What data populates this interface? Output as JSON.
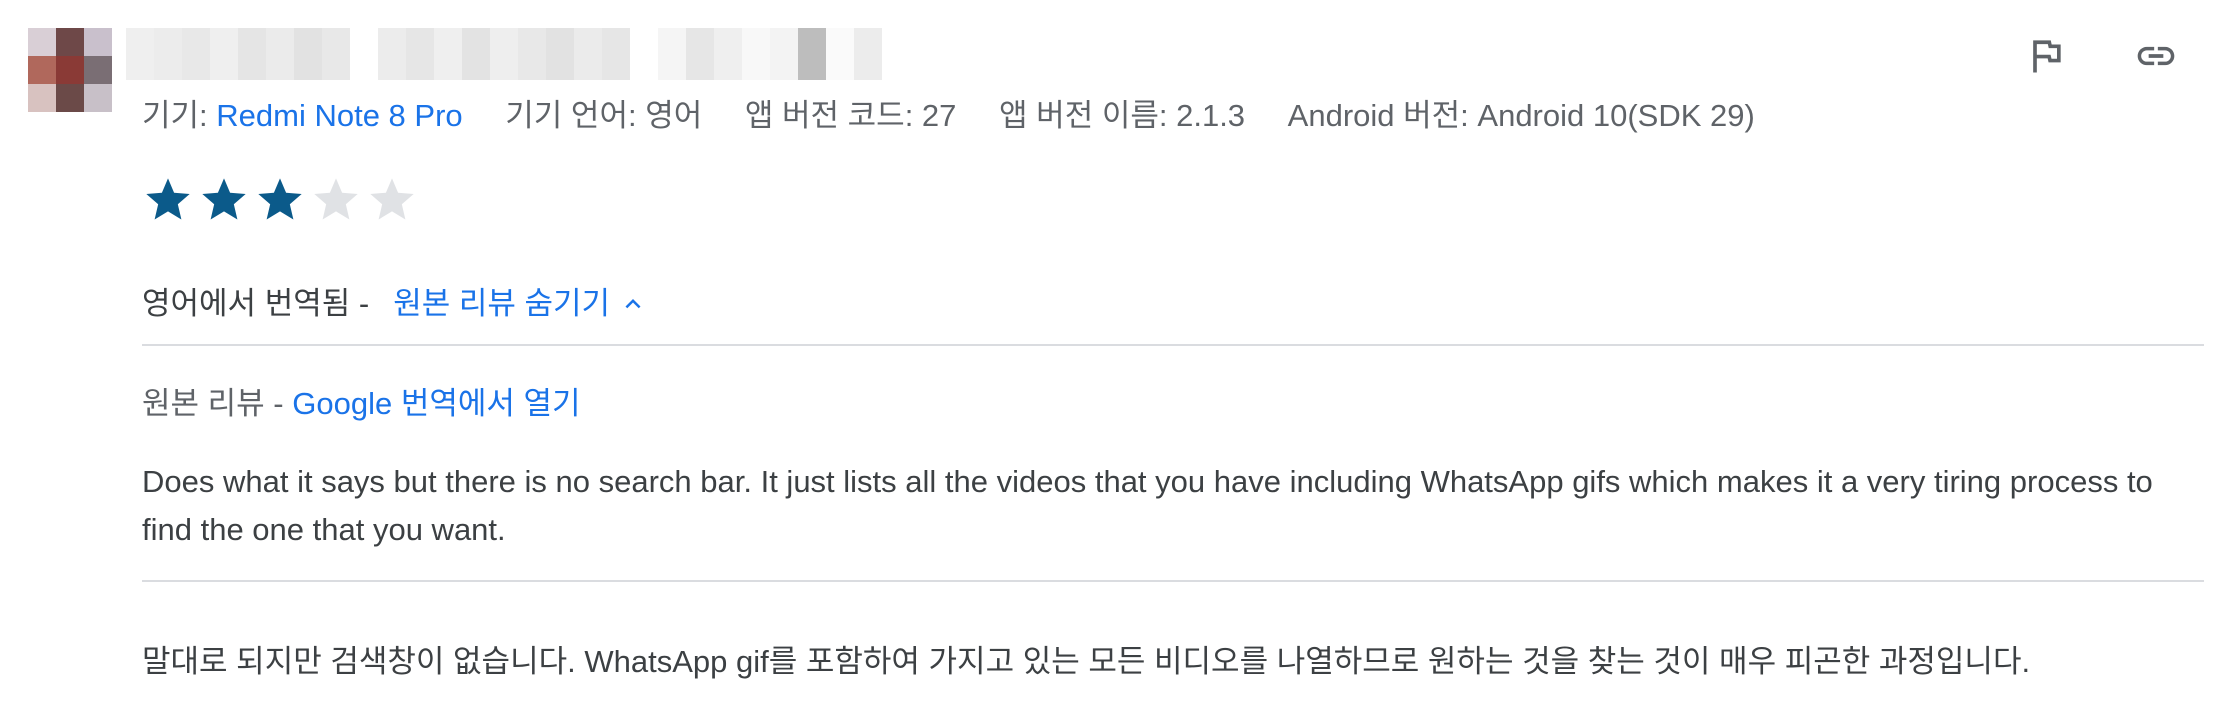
{
  "avatar_colors": [
    "#d9cfd6",
    "#6e4848",
    "#c9c0cc",
    "#b0685c",
    "#8a3a36",
    "#7a6e74",
    "#d8c2c0",
    "#6b4a48",
    "#c8c0c8"
  ],
  "name_mosaic_colors": [
    "#efefef",
    "#ececec",
    "#e8e8e8",
    "#efefef",
    "#e5e5e5",
    "#ebebeb",
    "#e2e2e2",
    "#e8e8e8",
    "#ffffff",
    "#ececec",
    "#e6e6e6",
    "#efefef",
    "#e3e3e3",
    "#eeeeee",
    "#e8e8e8",
    "#e2e2e2",
    "#ebebeb",
    "#e6e6e6",
    "#ffffff",
    "#f5f5f5",
    "#e6e6e6",
    "#efefef",
    "#f8f8f8",
    "#f3f3f3",
    "#bdbdbd",
    "#fafafa",
    "#ececec"
  ],
  "meta": {
    "device_label": "기기: ",
    "device_value": "Redmi Note 8 Pro",
    "language": "기기 언어: 영어",
    "version_code": "앱 버전 코드: 27",
    "version_name": "앱 버전 이름: 2.1.3",
    "android_version": "Android 버전: Android 10(SDK 29)"
  },
  "rating": 3,
  "rating_max": 5,
  "colors": {
    "star_filled": "#0b5a8a",
    "star_empty": "#e0e2e5",
    "link": "#1a73e8"
  },
  "translation": {
    "note": "영어에서 번역됨 -",
    "hide_original": "원본 리뷰 숨기기"
  },
  "original": {
    "label": "원본 리뷰 - ",
    "open_in_translate": "Google 번역에서 열기",
    "text": "Does what it says but there is no search bar. It just lists all the videos that you have including WhatsApp gifs which makes it a very tiring process to find the one that you want."
  },
  "translated_text": "말대로 되지만 검색창이 없습니다. WhatsApp gif를 포함하여 가지고 있는 모든 비디오를 나열하므로 원하는 것을 찾는 것이 매우 피곤한 과정입니다.",
  "actions": {
    "flag_icon": "flag-icon",
    "link_icon": "link-icon"
  }
}
